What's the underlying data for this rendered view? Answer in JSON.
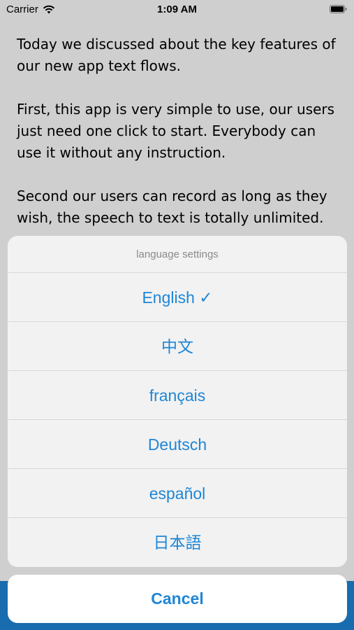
{
  "status_bar": {
    "carrier": "Carrier",
    "time": "1:09 AM"
  },
  "content": {
    "paragraphs": [
      "Today we discussed about the key features of our new app text flows.",
      "First, this app is very simple to use, our users just need one click to start. Everybody can use it without any instruction.",
      "Second our users can record as long as they wish, the speech to text is totally unlimited."
    ]
  },
  "action_sheet": {
    "title": "language settings",
    "options": [
      {
        "label": "English ✓"
      },
      {
        "label": "中文"
      },
      {
        "label": "français"
      },
      {
        "label": "Deutsch"
      },
      {
        "label": "español"
      },
      {
        "label": "日本語"
      }
    ],
    "cancel_label": "Cancel"
  },
  "colors": {
    "accent": "#1f86d6",
    "sheet_background": "#f3f3f3",
    "title_text": "#8a8a8e"
  }
}
